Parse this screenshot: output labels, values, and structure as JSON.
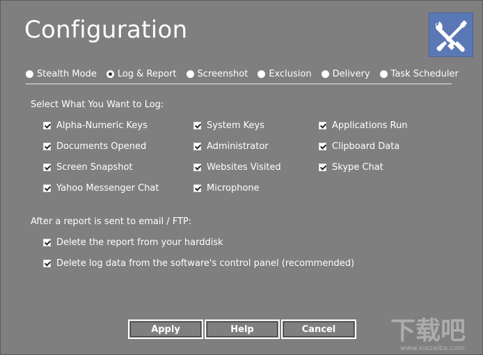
{
  "window": {
    "title": "Configuration",
    "logo_icon": "tools-icon",
    "accent": "#5b78b6",
    "background": "#7f7f7f"
  },
  "tabs": [
    {
      "label": "Stealth Mode",
      "selected": false
    },
    {
      "label": "Log & Report",
      "selected": true
    },
    {
      "label": "Screenshot",
      "selected": false
    },
    {
      "label": "Exclusion",
      "selected": false
    },
    {
      "label": "Delivery",
      "selected": false
    },
    {
      "label": "Task Scheduler",
      "selected": false
    }
  ],
  "log_section": {
    "heading": "Select What You Want to Log:",
    "items": [
      {
        "label": "Alpha-Numeric Keys",
        "checked": true
      },
      {
        "label": "System Keys",
        "checked": true
      },
      {
        "label": "Applications Run",
        "checked": true
      },
      {
        "label": "Documents Opened",
        "checked": true
      },
      {
        "label": "Administrator",
        "checked": true
      },
      {
        "label": "Clipboard Data",
        "checked": true
      },
      {
        "label": "Screen Snapshot",
        "checked": true
      },
      {
        "label": "Websites Visited",
        "checked": true
      },
      {
        "label": "Skype Chat",
        "checked": true
      },
      {
        "label": "Yahoo Messenger Chat",
        "checked": true
      },
      {
        "label": "Microphone",
        "checked": true
      }
    ]
  },
  "report_section": {
    "heading": "After a report is sent to email / FTP:",
    "items": [
      {
        "label": "Delete the report from your harddisk",
        "checked": true
      },
      {
        "label": "Delete log data from the software's control panel (recommended)",
        "checked": true
      }
    ]
  },
  "buttons": {
    "apply": "Apply",
    "help": "Help",
    "cancel": "Cancel"
  },
  "watermark": {
    "text": "下载吧",
    "url_text": "www.xiazaiba.com"
  }
}
